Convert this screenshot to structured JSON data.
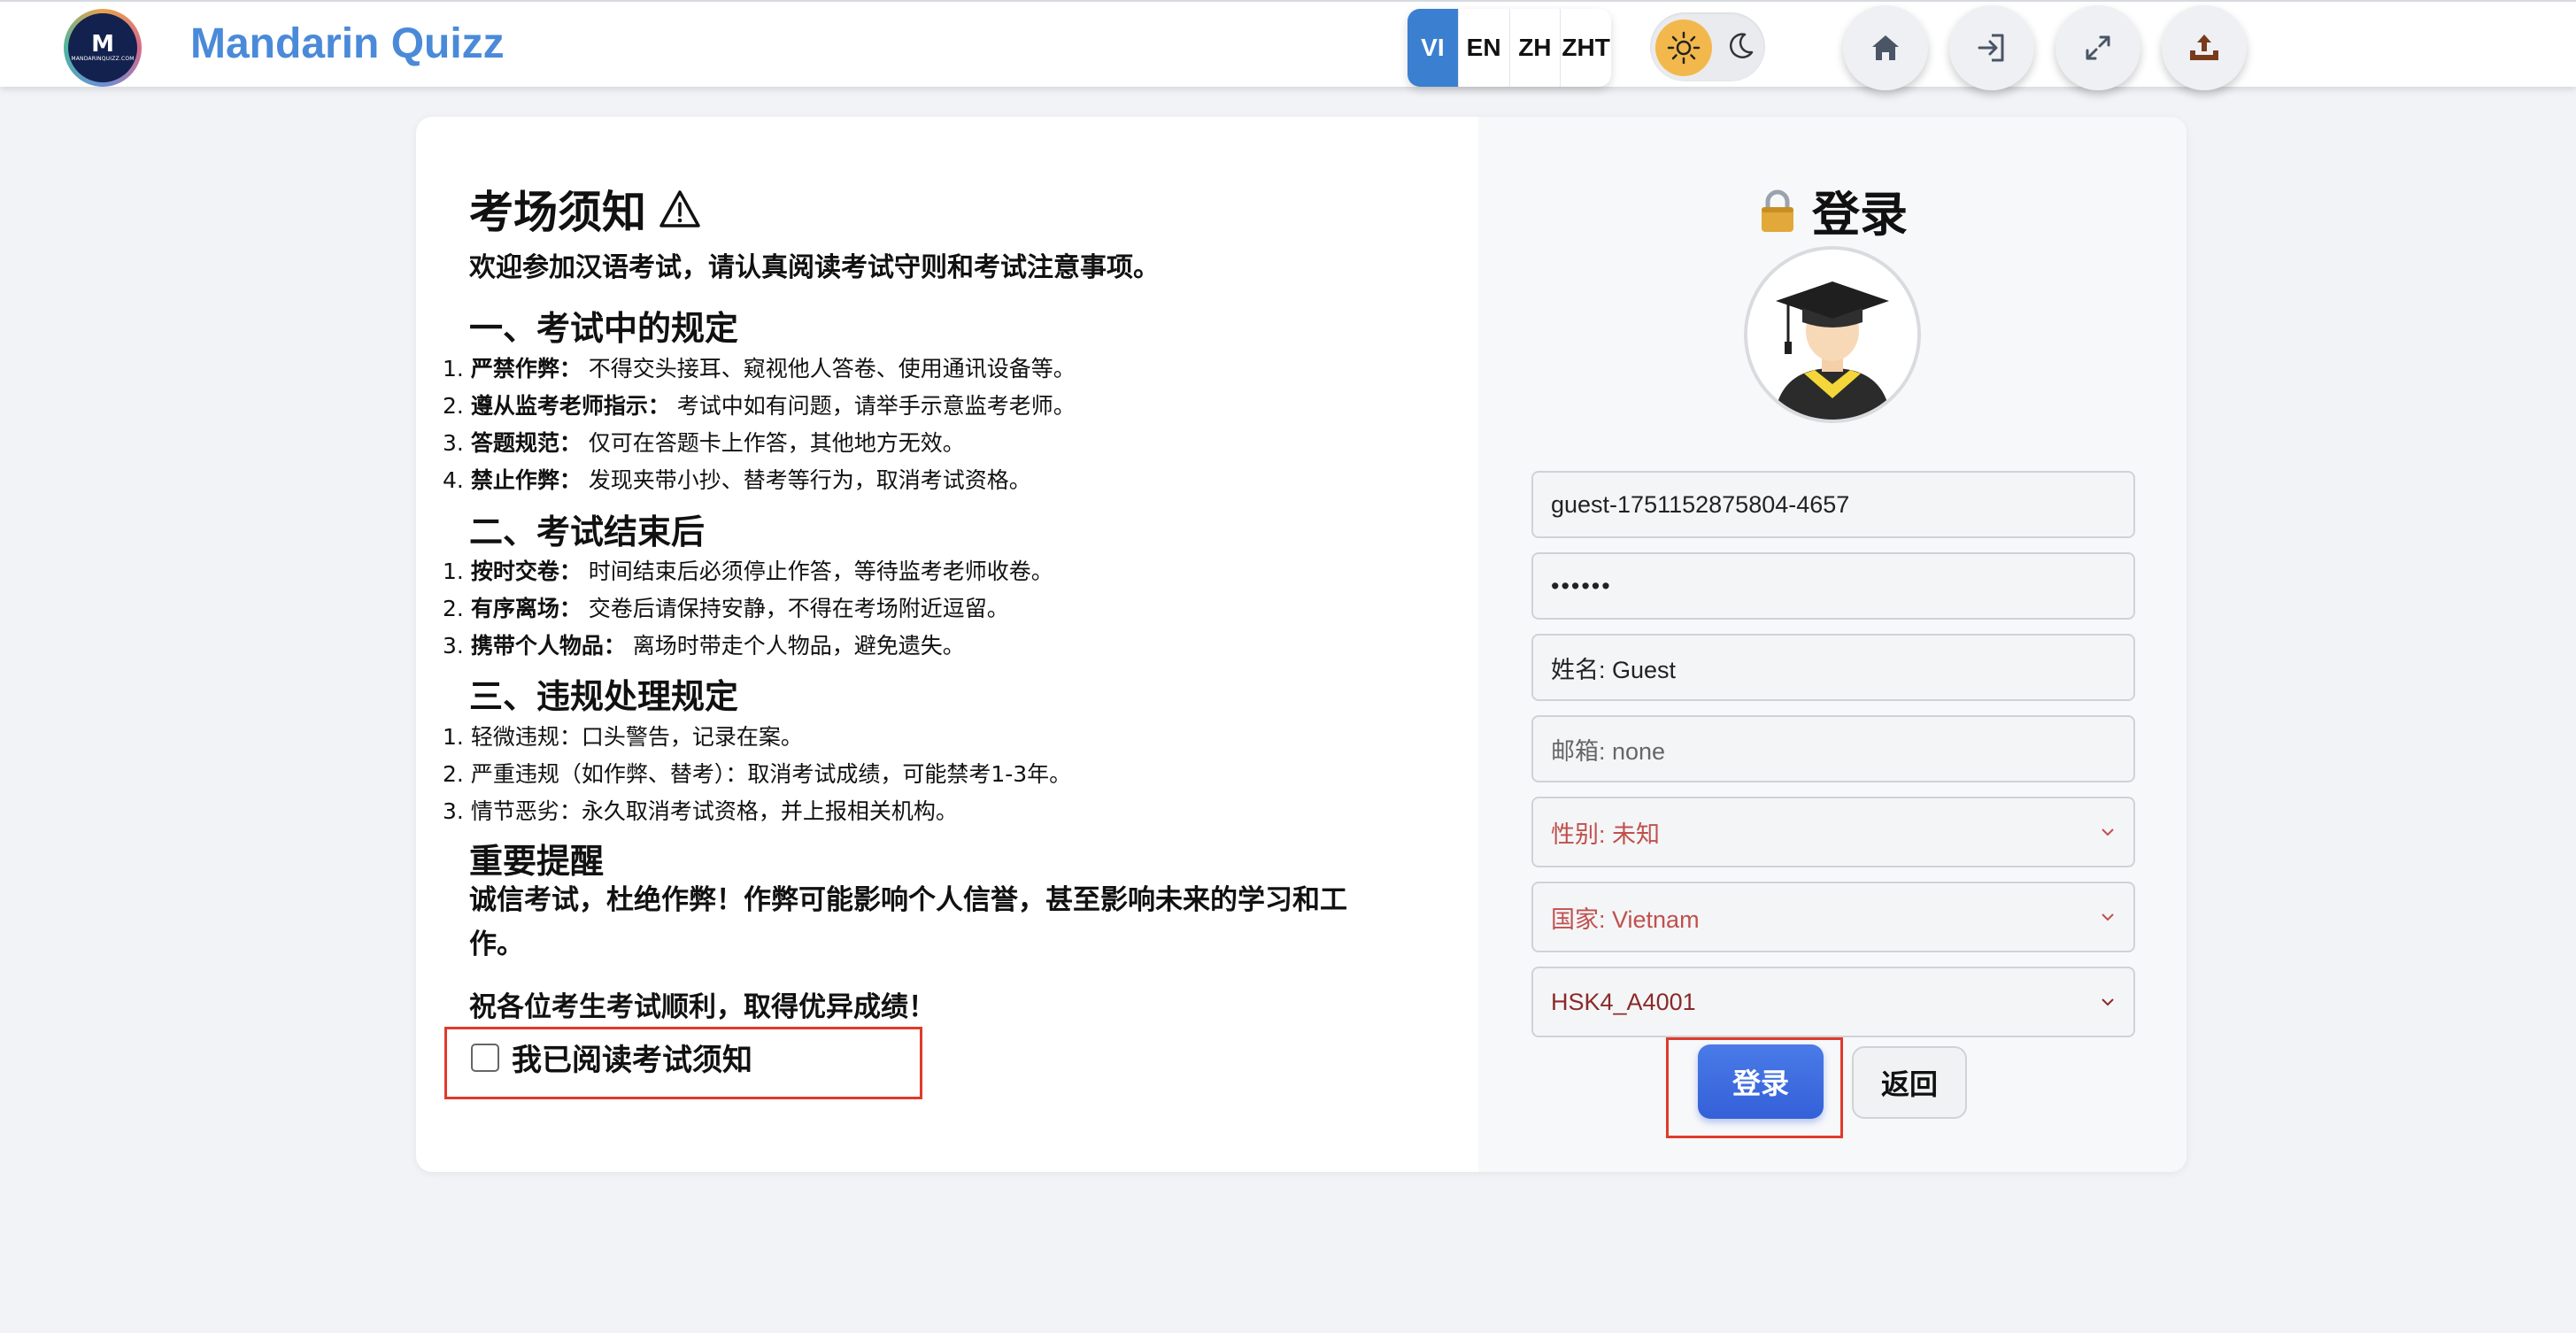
{
  "header": {
    "logo_letter": "M",
    "logo_small_text": "MANDARINQUIZZ.COM",
    "brand": "Mandarin Quizz",
    "languages": [
      {
        "label": "VI",
        "active": true
      },
      {
        "label": "EN",
        "active": false
      },
      {
        "label": "ZH",
        "active": false
      },
      {
        "label": "ZHT",
        "active": false
      }
    ],
    "theme": {
      "sun_icon": "sun-icon",
      "moon_icon": "moon-icon",
      "accent": "#f2b84b"
    },
    "nav_icons": [
      "home-icon",
      "login-icon",
      "fullscreen-icon",
      "upload-icon"
    ]
  },
  "notice": {
    "title": "考场须知",
    "title_icon": "warning-icon",
    "intro": "欢迎参加汉语考试，请认真阅读考试守则和考试注意事项。",
    "section1": {
      "heading": "一、考试中的规定",
      "items": [
        {
          "num": "1.",
          "bold": "严禁作弊：",
          "text": "不得交头接耳、窥视他人答卷、使用通讯设备等。"
        },
        {
          "num": "2.",
          "bold": "遵从监考老师指示：",
          "text": "考试中如有问题，请举手示意监考老师。"
        },
        {
          "num": "3.",
          "bold": "答题规范：",
          "text": "仅可在答题卡上作答，其他地方无效。"
        },
        {
          "num": "4.",
          "bold": "禁止作弊：",
          "text": "发现夹带小抄、替考等行为，取消考试资格。"
        }
      ]
    },
    "section2": {
      "heading": "二、考试结束后",
      "items": [
        {
          "num": "1.",
          "bold": "按时交卷：",
          "text": "时间结束后必须停止作答，等待监考老师收卷。"
        },
        {
          "num": "2.",
          "bold": "有序离场：",
          "text": "交卷后请保持安静，不得在考场附近逗留。"
        },
        {
          "num": "3.",
          "bold": "携带个人物品：",
          "text": "离场时带走个人物品，避免遗失。"
        }
      ]
    },
    "section3": {
      "heading": "三、违规处理规定",
      "items": [
        {
          "num": "1.",
          "text": "轻微违规：口头警告，记录在案。"
        },
        {
          "num": "2.",
          "text": "严重违规（如作弊、替考）：取消考试成绩，可能禁考1-3年。"
        },
        {
          "num": "3.",
          "text": "情节恶劣：永久取消考试资格，并上报相关机构。"
        }
      ]
    },
    "reminder_heading": "重要提醒",
    "reminder_body": "诚信考试，杜绝作弊！作弊可能影响个人信誉，甚至影响未来的学习和工作。",
    "wish": "祝各位考生考试顺利，取得优异成绩！",
    "agree_label": "我已阅读考试须知"
  },
  "login": {
    "title": "登录",
    "title_icon": "lock-icon",
    "avatar_icon": "graduate-avatar-icon",
    "username": "guest-1751152875804-4657",
    "password": "••••••",
    "name": "姓名: Guest",
    "email_placeholder": "邮箱: none",
    "gender": "性别: 未知",
    "country": "国家: Vietnam",
    "exam": "HSK4_A4001",
    "submit_label": "登录",
    "back_label": "返回"
  }
}
